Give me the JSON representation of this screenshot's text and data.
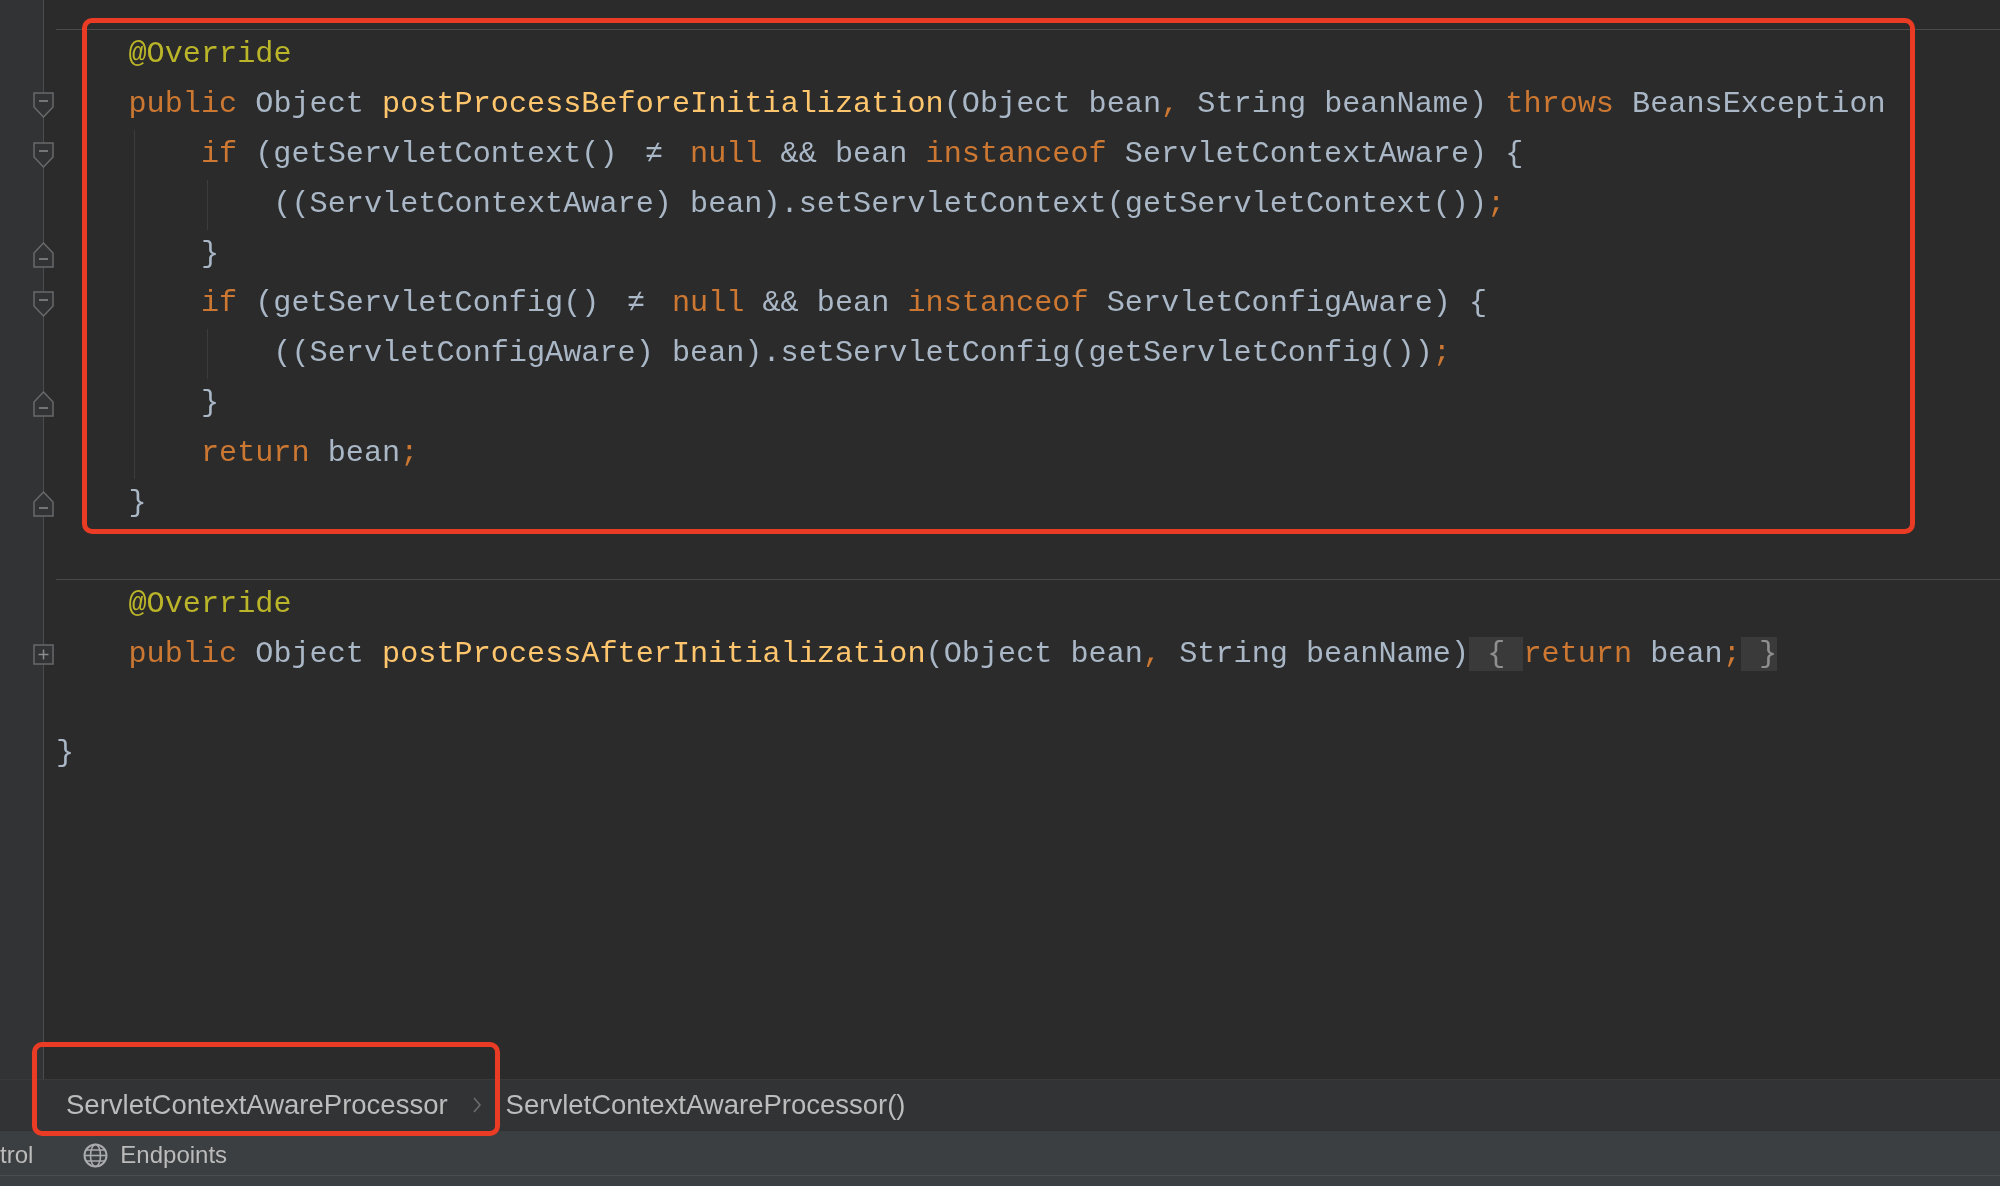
{
  "editor": {
    "members": [
      {
        "highlighted": true,
        "lines": [
          {
            "kind": "plain",
            "tokens": [
              {
                "kind": "annotation",
                "text": "@Override"
              }
            ]
          },
          {
            "kind": "opener",
            "tokens": [
              {
                "kind": "keyword",
                "text": "public"
              },
              {
                "kind": "plain",
                "text": " Object "
              },
              {
                "kind": "method",
                "text": "postProcessBeforeInitialization"
              },
              {
                "kind": "plain",
                "text": "(Object bean"
              },
              {
                "kind": "punct",
                "text": ","
              },
              {
                "kind": "plain",
                "text": " String beanName) "
              },
              {
                "kind": "keyword",
                "text": "throws"
              },
              {
                "kind": "plain",
                "text": " BeansException"
              }
            ],
            "children": [
              {
                "kind": "opener",
                "tokens": [
                  {
                    "kind": "keyword",
                    "text": "if"
                  },
                  {
                    "kind": "plain",
                    "text": " (getServletContext() "
                  },
                  {
                    "kind": "op",
                    "text": "≠"
                  },
                  {
                    "kind": "keyword",
                    "text": " null"
                  },
                  {
                    "kind": "plain",
                    "text": " && bean "
                  },
                  {
                    "kind": "keyword",
                    "text": "instanceof"
                  },
                  {
                    "kind": "plain",
                    "text": " ServletContextAware) {"
                  }
                ],
                "children": [
                  {
                    "kind": "plain",
                    "tokens": [
                      {
                        "kind": "plain",
                        "text": "((ServletContextAware) bean).setServletContext(getServletContext())"
                      },
                      {
                        "kind": "punct",
                        "text": ";"
                      }
                    ]
                  }
                ]
              },
              {
                "kind": "closer",
                "tokens": [
                  {
                    "kind": "plain",
                    "text": "}"
                  }
                ]
              },
              {
                "kind": "opener",
                "tokens": [
                  {
                    "kind": "keyword",
                    "text": "if"
                  },
                  {
                    "kind": "plain",
                    "text": " (getServletConfig() "
                  },
                  {
                    "kind": "op",
                    "text": "≠"
                  },
                  {
                    "kind": "keyword",
                    "text": " null"
                  },
                  {
                    "kind": "plain",
                    "text": " && bean "
                  },
                  {
                    "kind": "keyword",
                    "text": "instanceof"
                  },
                  {
                    "kind": "plain",
                    "text": " ServletConfigAware) {"
                  }
                ],
                "children": [
                  {
                    "kind": "plain",
                    "tokens": [
                      {
                        "kind": "plain",
                        "text": "((ServletConfigAware) bean).setServletConfig(getServletConfig())"
                      },
                      {
                        "kind": "punct",
                        "text": ";"
                      }
                    ]
                  }
                ]
              },
              {
                "kind": "closer",
                "tokens": [
                  {
                    "kind": "plain",
                    "text": "}"
                  }
                ]
              },
              {
                "kind": "plain",
                "tokens": [
                  {
                    "kind": "keyword",
                    "text": "return"
                  },
                  {
                    "kind": "plain",
                    "text": " bean"
                  },
                  {
                    "kind": "punct",
                    "text": ";"
                  }
                ]
              }
            ]
          },
          {
            "kind": "closer",
            "tokens": [
              {
                "kind": "plain",
                "text": "}"
              }
            ]
          }
        ]
      },
      {
        "highlighted": false,
        "lines": [
          {
            "kind": "plain",
            "tokens": [
              {
                "kind": "annotation",
                "text": "@Override"
              }
            ]
          },
          {
            "kind": "collapsed",
            "tokens": [
              {
                "kind": "keyword",
                "text": "public"
              },
              {
                "kind": "plain",
                "text": " Object "
              },
              {
                "kind": "method",
                "text": "postProcessAfterInitialization"
              },
              {
                "kind": "plain",
                "text": "(Object bean"
              },
              {
                "kind": "punct",
                "text": ","
              },
              {
                "kind": "plain",
                "text": " String beanName)"
              },
              {
                "kind": "folded",
                "text": " { "
              },
              {
                "kind": "keyword",
                "text": "return"
              },
              {
                "kind": "plain",
                "text": " bean"
              },
              {
                "kind": "punct",
                "text": ";"
              },
              {
                "kind": "folded",
                "text": " }"
              }
            ]
          }
        ]
      }
    ],
    "class_end": {
      "kind": "plain",
      "tokens": [
        {
          "kind": "plain",
          "text": "}"
        }
      ]
    }
  },
  "breadcrumbs": [
    {
      "label": "ServletContextAwareProcessor",
      "highlighted": true
    },
    {
      "label": "ServletContextAwareProcessor()",
      "highlighted": false
    }
  ],
  "tool_strip": {
    "cut_label": "trol",
    "buttons": [
      {
        "label": "Endpoints"
      }
    ]
  }
}
